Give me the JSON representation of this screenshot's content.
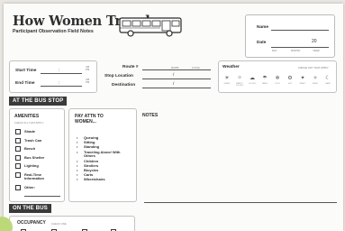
{
  "header": {
    "title": "How Women Travel",
    "subtitle": "Participant Observation Field Notes"
  },
  "meta": {
    "name_label": "Name",
    "date_label": "Date",
    "year_prefix": "20",
    "date_day": "DAY",
    "date_month": "MONTH",
    "date_year": "YEAR"
  },
  "time": {
    "start_label": "Start Time",
    "end_label": "End Time",
    "separator": ":",
    "am": "AM",
    "pm": "PM"
  },
  "route": {
    "route_label": "Route #",
    "stop_label": "Stop Location",
    "destination_label": "Destination",
    "rapid": "RAPID",
    "local": "LOCAL",
    "slash": "/"
  },
  "weather": {
    "label": "Weather",
    "hint": "CIRCLE ANY THAT APPLY",
    "options": [
      {
        "icon": "☀",
        "name": "SUNNY"
      },
      {
        "icon": "☼",
        "name": "PARTLY CLOUDY"
      },
      {
        "icon": "☁",
        "name": "CLOUDY"
      },
      {
        "icon": "☂",
        "name": "RAINY"
      },
      {
        "icon": "❄",
        "name": "COLD"
      },
      {
        "icon": "⚙",
        "name": "HOT"
      },
      {
        "icon": "✦",
        "name": "WINDY"
      },
      {
        "icon": "✧",
        "name": "NIGHT"
      },
      {
        "icon": "☾",
        "name": "DARK"
      }
    ]
  },
  "sections": {
    "bus_stop": "AT THE BUS STOP",
    "on_bus": "ON THE BUS"
  },
  "amenities": {
    "heading": "AMENITIES",
    "hint": "CHECK ALL THAT APPLY",
    "items": [
      "Shade",
      "Trash Can",
      "Bench",
      "Bus Shelter",
      "Lighting",
      "Real-Time Information",
      "Other:"
    ]
  },
  "attention": {
    "heading": "PAY ATTN TO WOMEN...",
    "items": [
      "Queuing",
      "Sitting",
      "Standing",
      "Traveling Alone/ With Others",
      "Children",
      "Strollers",
      "Bicycles",
      "Carts",
      "Wheelchairs"
    ]
  },
  "notes": {
    "heading": "NOTES"
  },
  "occupancy": {
    "heading": "OCCUPANCY",
    "hint": "CHECK ONE"
  }
}
